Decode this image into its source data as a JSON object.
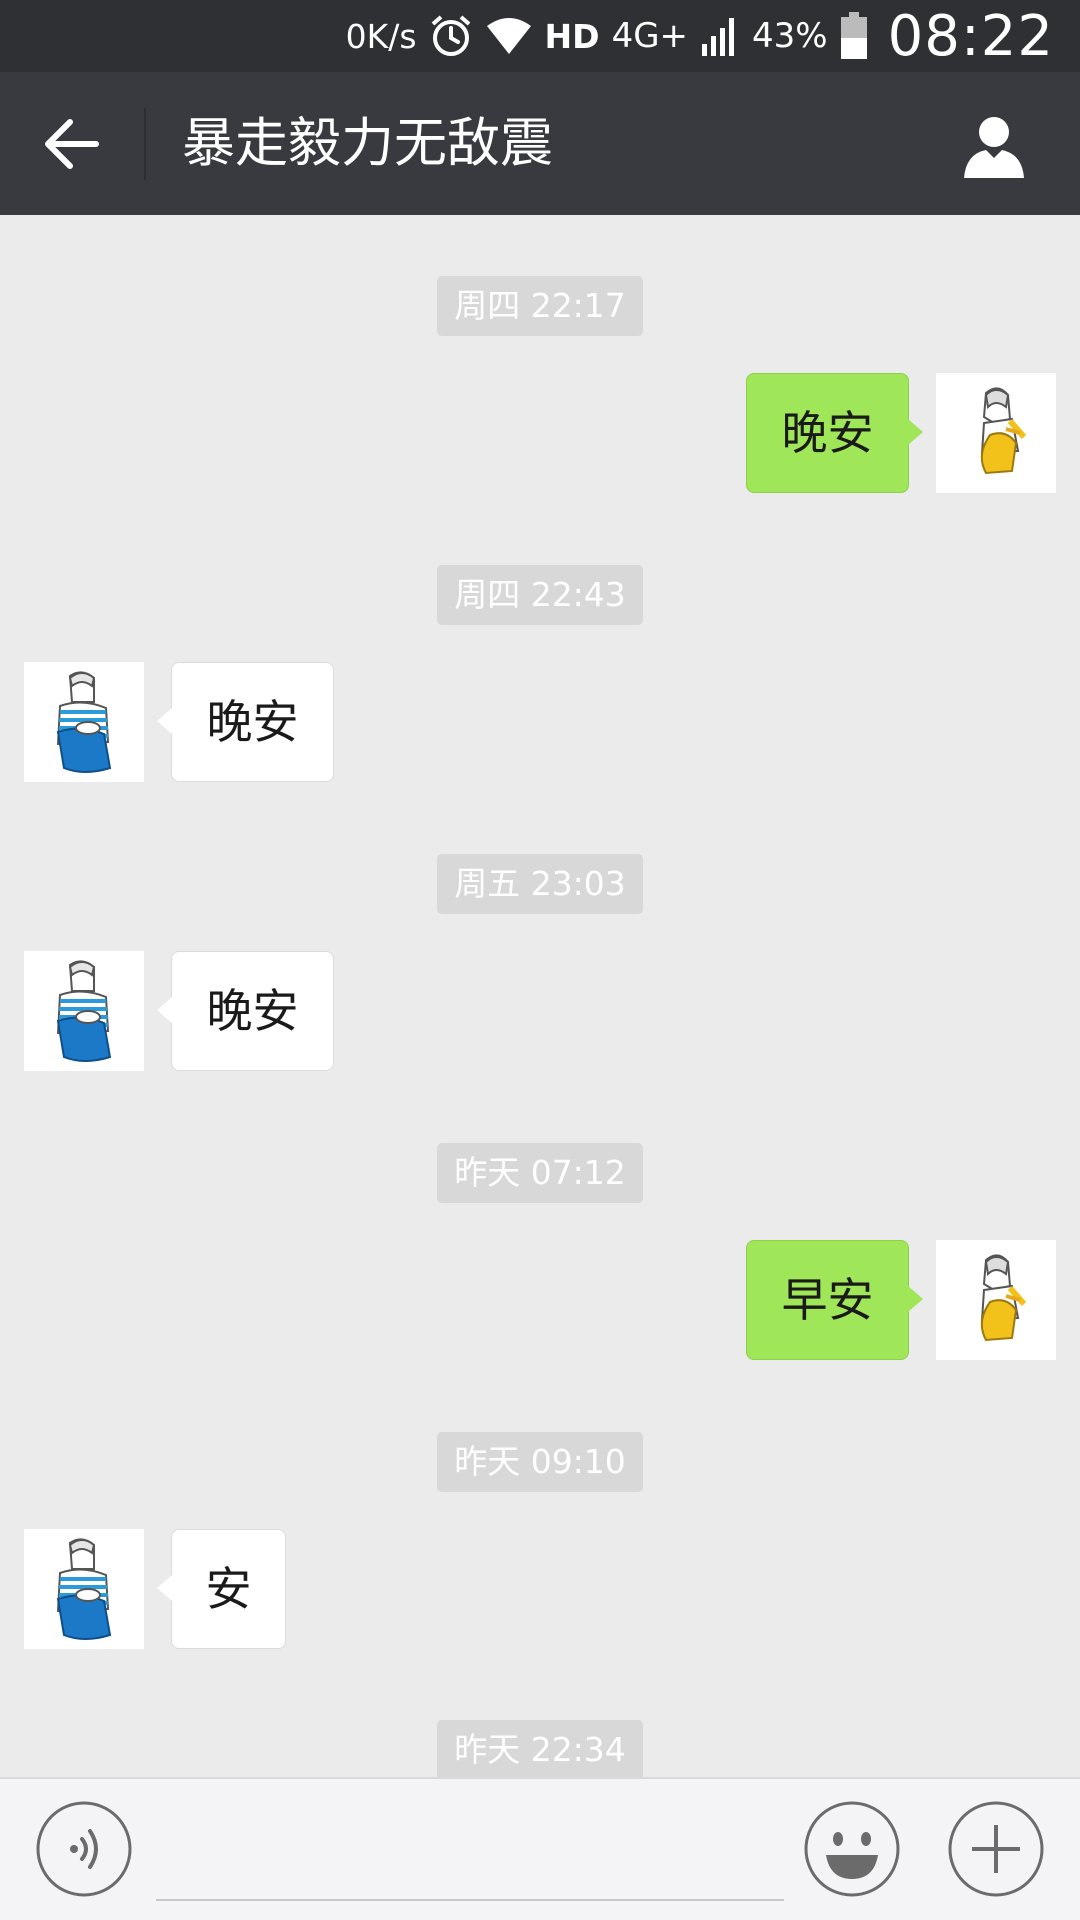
{
  "status_bar": {
    "speed": "0K/s",
    "hd": "HD",
    "network": "4G+",
    "battery": "43%",
    "time": "08:22"
  },
  "header": {
    "title": "暴走毅力无敌震"
  },
  "messages": [
    {
      "type": "timestamp",
      "text": "周四 22:17"
    },
    {
      "type": "sent",
      "text": "晚安"
    },
    {
      "type": "timestamp",
      "text": "周四 22:43"
    },
    {
      "type": "received",
      "text": "晚安"
    },
    {
      "type": "timestamp",
      "text": "周五 23:03"
    },
    {
      "type": "received",
      "text": "晚安"
    },
    {
      "type": "timestamp",
      "text": "昨天 07:12"
    },
    {
      "type": "sent",
      "text": "早安"
    },
    {
      "type": "timestamp",
      "text": "昨天 09:10"
    },
    {
      "type": "received",
      "text": "安"
    },
    {
      "type": "timestamp",
      "text": "昨天 22:34"
    }
  ],
  "input_bar": {
    "input_value": "",
    "icons": [
      "voice-icon",
      "emoji-icon",
      "plus-icon"
    ]
  },
  "colors": {
    "sent_bubble": "#9fe658",
    "received_bubble": "#ffffff",
    "header_bg": "#393a3f",
    "chat_bg": "#ebebeb"
  }
}
